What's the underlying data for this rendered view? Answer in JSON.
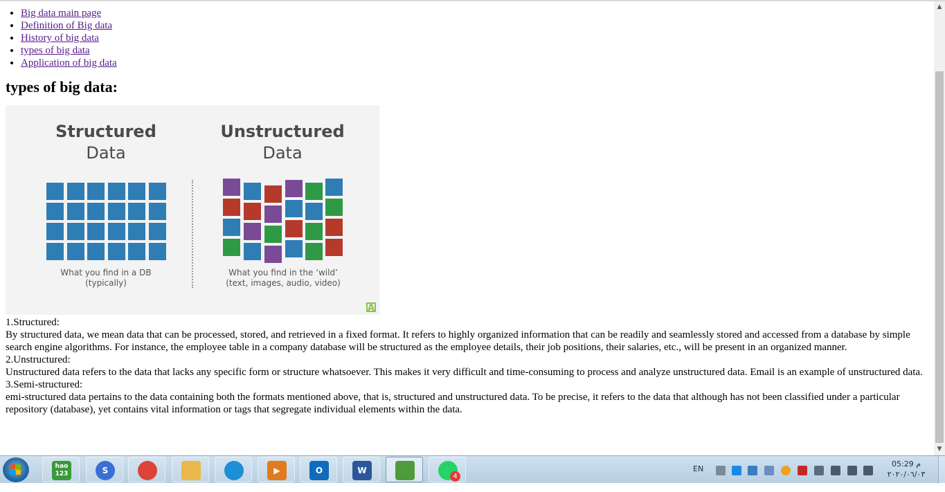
{
  "nav": {
    "items": [
      {
        "label": "Big data main page"
      },
      {
        "label": "Definition of Big data"
      },
      {
        "label": "History of big data"
      },
      {
        "label": "types of big data"
      },
      {
        "label": "Application of big data"
      }
    ]
  },
  "heading": "types of big data:",
  "figure": {
    "structured_title_1": "Structured",
    "structured_title_2": "Data",
    "unstructured_title_1": "Unstructured",
    "unstructured_title_2": "Data",
    "structured_caption_1": "What you find in a DB",
    "structured_caption_2": "(typically)",
    "unstructured_caption_1": "What you find in the ‘wild’",
    "unstructured_caption_2": "(text, images, audio, video)",
    "colors": {
      "blue": "#2e7db5",
      "red": "#b53a2c",
      "purple": "#7b4a96",
      "green": "#2f9a46"
    }
  },
  "sections": [
    {
      "title": "1.Structured:",
      "text": "By structured data, we mean data that can be processed, stored, and retrieved in a fixed format. It refers to highly organized information that can be readily and seamlessly stored and accessed from a database by simple search engine algorithms. For instance, the employee table in a company database will be structured as the employee details, their job positions, their salaries, etc., will be present in an organized manner."
    },
    {
      "title": "2.Unstructured:",
      "text": "Unstructured data refers to the data that lacks any specific form or structure whatsoever. This makes it very difficult and time-consuming to process and analyze unstructured data. Email is an example of unstructured data."
    },
    {
      "title": "3.Semi-structured:",
      "text": "emi-structured data pertains to the data containing both the formats mentioned above, that is, structured and unstructured data. To be precise, it refers to the data that although has not been classified under a particular repository (database), yet contains vital information or tags that segregate individual elements within the data."
    }
  ],
  "taskbar": {
    "apps": [
      {
        "name": "hao123",
        "label": "hao\n123",
        "color": "#3a9a3a"
      },
      {
        "name": "browser-360",
        "label": "S",
        "color": "#3b6fd6"
      },
      {
        "name": "chrome",
        "label": "",
        "color": "#db4437"
      },
      {
        "name": "file-explorer",
        "label": "",
        "color": "#e8b84a"
      },
      {
        "name": "media-player",
        "label": "",
        "color": "#1c8fd6"
      },
      {
        "name": "video-player",
        "label": "▶",
        "color": "#e07b1e"
      },
      {
        "name": "outlook",
        "label": "O",
        "color": "#0f6cbd"
      },
      {
        "name": "word",
        "label": "W",
        "color": "#2b579a"
      },
      {
        "name": "notepad-chart",
        "label": "",
        "color": "#4f9a3a"
      },
      {
        "name": "whatsapp",
        "label": "",
        "color": "#25d366"
      }
    ],
    "whatsapp_badge": "4",
    "language": "EN",
    "time": "05:29 م",
    "date": "٢٠٢٠/٠٦/٠٣"
  }
}
